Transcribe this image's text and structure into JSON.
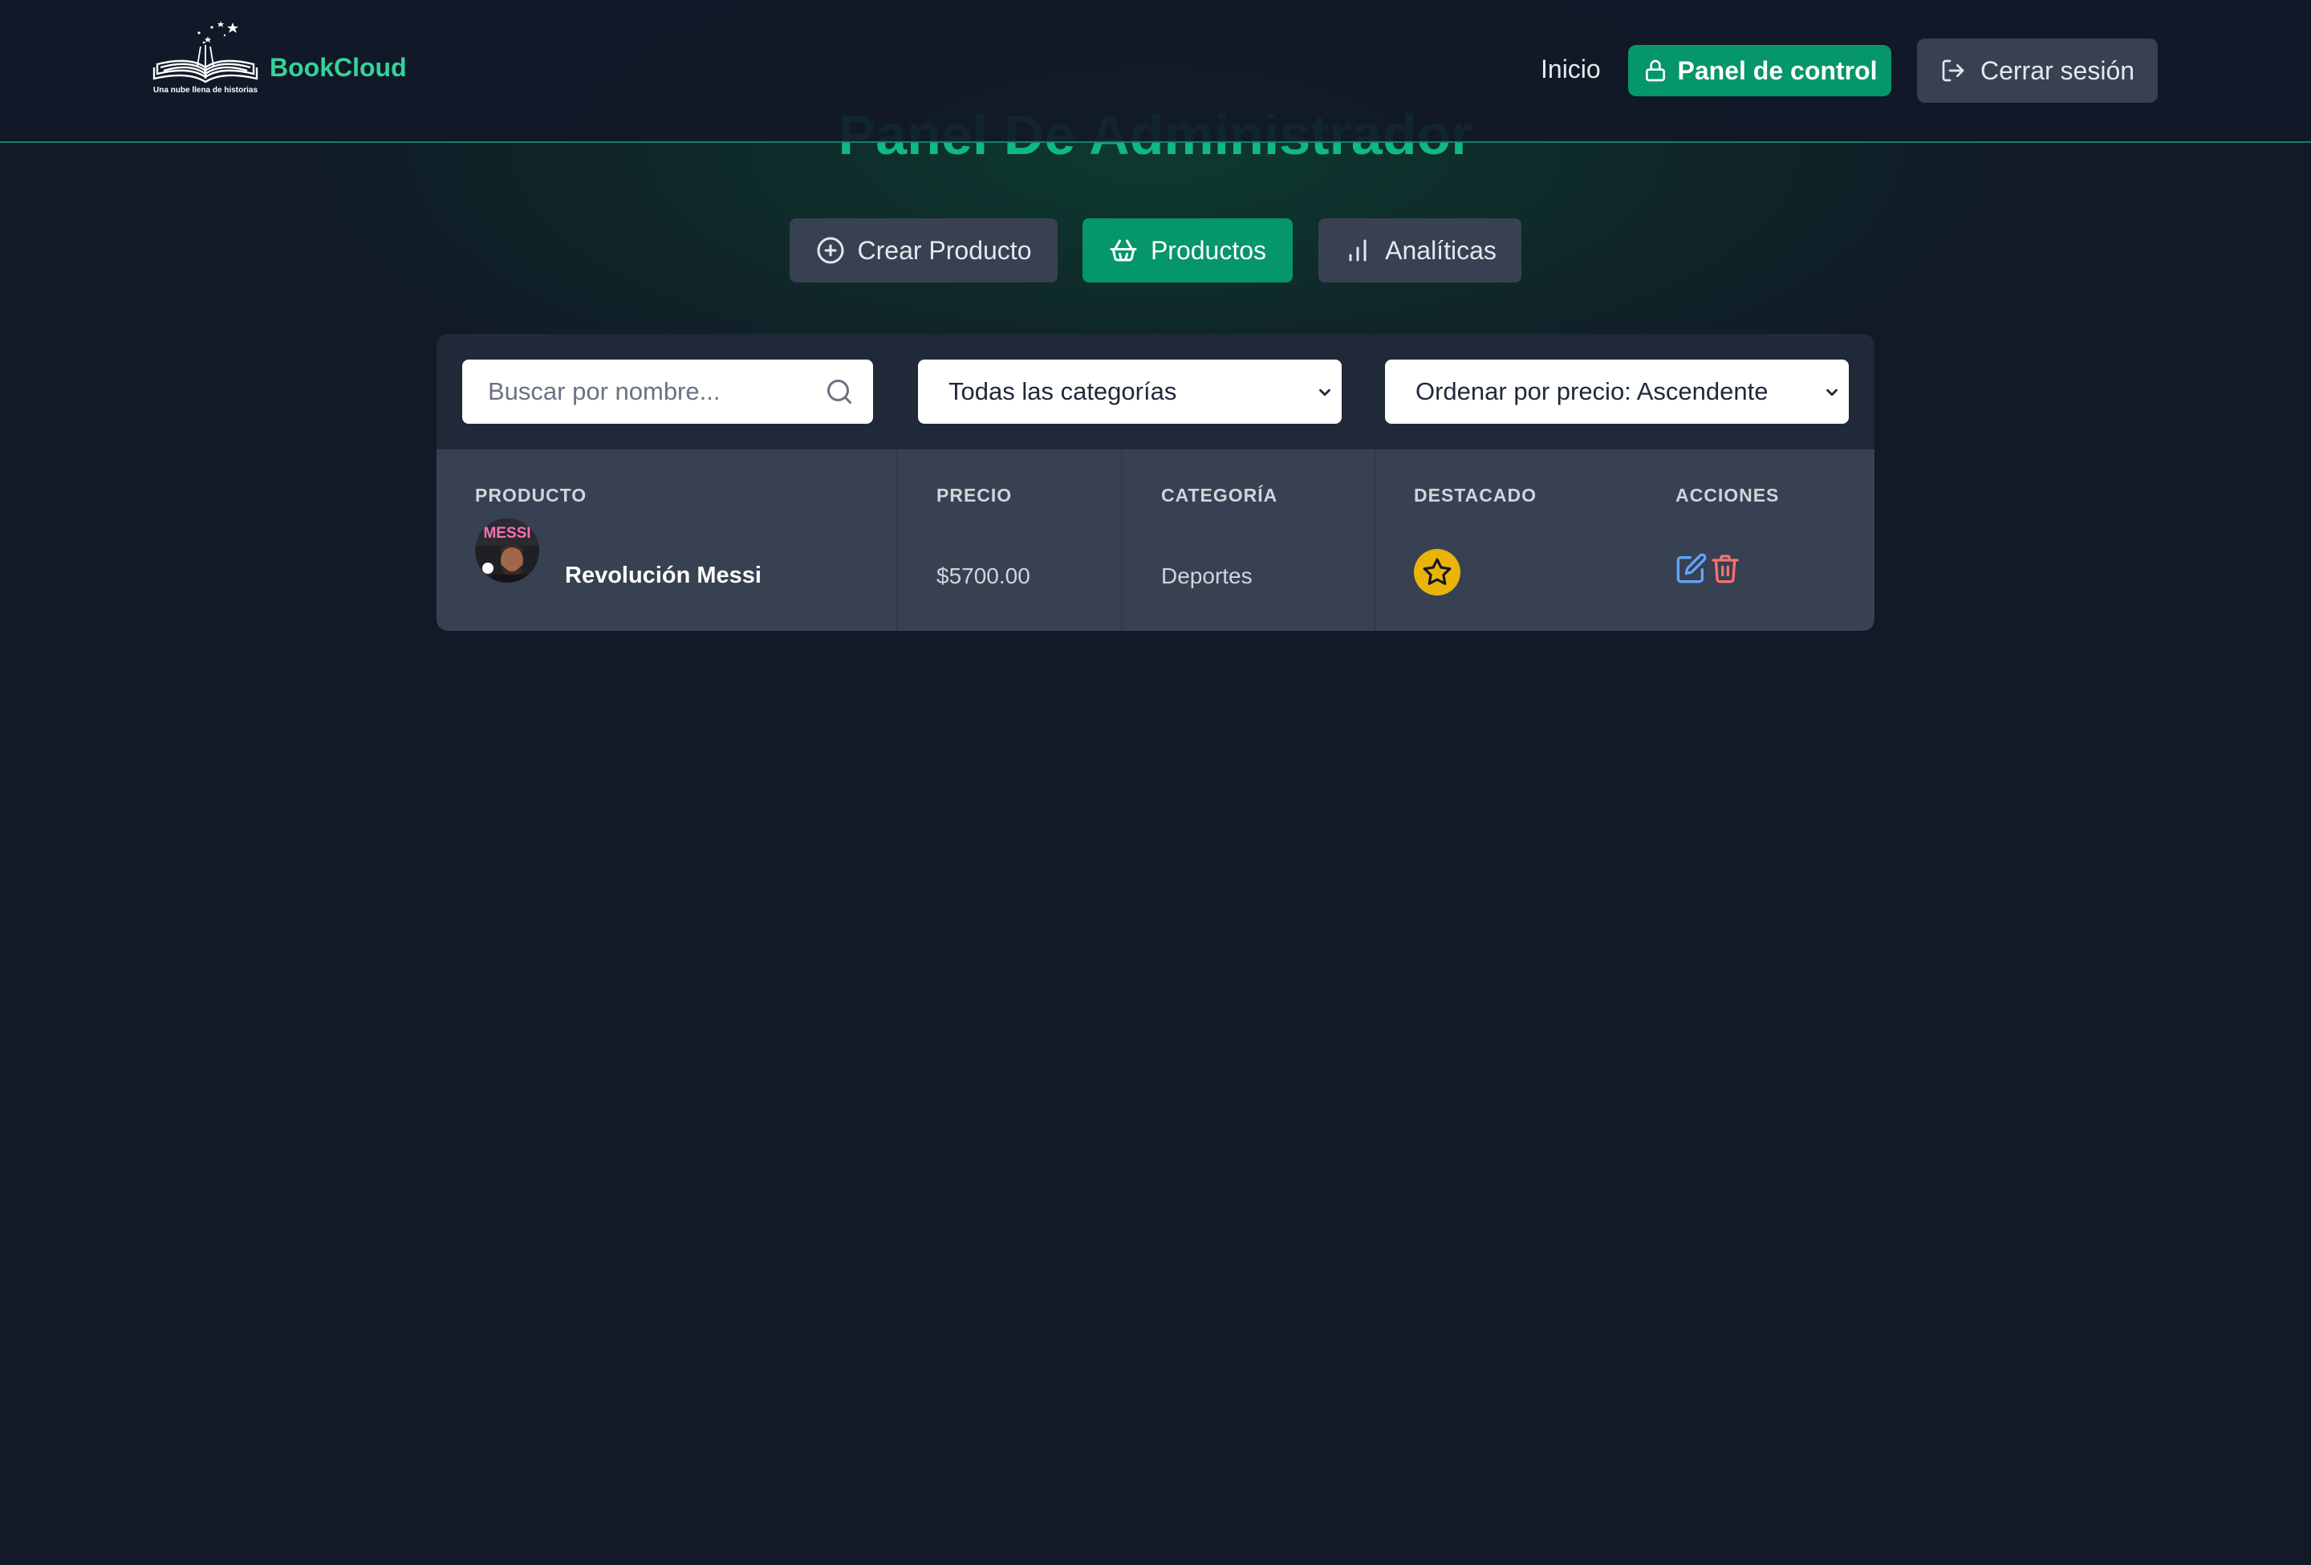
{
  "header": {
    "logo_tagline": "Una nube llena de historias",
    "brand": "BookCloud",
    "nav": {
      "home": "Inicio",
      "panel": "Panel de control",
      "logout": "Cerrar sesión"
    }
  },
  "page": {
    "title": "Panel De Administrador"
  },
  "tabs": [
    {
      "label": "Crear Producto",
      "icon": "plus-circle-icon"
    },
    {
      "label": "Productos",
      "icon": "shopping-basket-icon",
      "active": true
    },
    {
      "label": "Analíticas",
      "icon": "bar-chart-icon"
    }
  ],
  "filters": {
    "search_placeholder": "Buscar por nombre...",
    "category_selected": "Todas las categorías",
    "sort_selected": "Ordenar por precio: Ascendente"
  },
  "table": {
    "headers": [
      "PRODUCTO",
      "PRECIO",
      "CATEGORÍA",
      "DESTACADO",
      "ACCIONES"
    ],
    "rows": [
      {
        "name": "Revolución Messi",
        "price": "$5700.00",
        "category": "Deportes",
        "featured": true
      }
    ]
  },
  "colors": {
    "accent": "#10b981",
    "button_active": "#059669",
    "featured": "#eab308",
    "edit": "#60a5fa",
    "delete": "#f87171"
  }
}
